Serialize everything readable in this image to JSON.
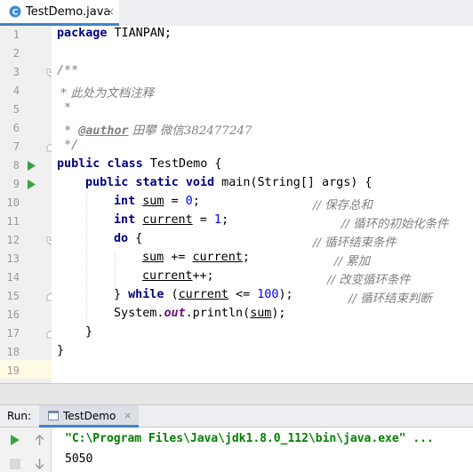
{
  "tab": {
    "filename": "TestDemo.java",
    "close": "×",
    "icon": "java-class-icon"
  },
  "lines": [
    {
      "n": "1"
    },
    {
      "n": "2"
    },
    {
      "n": "3"
    },
    {
      "n": "4"
    },
    {
      "n": "5"
    },
    {
      "n": "6"
    },
    {
      "n": "7"
    },
    {
      "n": "8"
    },
    {
      "n": "9"
    },
    {
      "n": "10"
    },
    {
      "n": "11"
    },
    {
      "n": "12"
    },
    {
      "n": "13"
    },
    {
      "n": "14"
    },
    {
      "n": "15"
    },
    {
      "n": "16"
    },
    {
      "n": "17"
    },
    {
      "n": "18"
    },
    {
      "n": "19"
    }
  ],
  "code": {
    "l1_kw": "package",
    "l1_rest": " TIANPAN;",
    "l3": "/**",
    "l4": " * 此处为文档注释",
    "l5": " *",
    "l6_a": " * ",
    "l6_tag": "@author",
    "l6_b": " 田攀 微信382477247",
    "l7": " */",
    "l8_kw": "public class",
    "l8_rest": " TestDemo {",
    "l9_kw": "public static void",
    "l9_rest": " main(String[] args) {",
    "l10_kw": "int",
    "l10_var": "sum",
    "l10_a": " = ",
    "l10_num": "0",
    "l10_b": ";",
    "l10_cmt": "// 保存总和",
    "l11_kw": "int",
    "l11_var": "current",
    "l11_a": " = ",
    "l11_num": "1",
    "l11_b": ";",
    "l11_cmt": "// 循环的初始化条件",
    "l12_kw": "do",
    "l12_rest": " {",
    "l12_cmt": "// 循环结束条件",
    "l13_var1": "sum",
    "l13_a": " += ",
    "l13_var2": "current",
    "l13_b": ";",
    "l13_cmt": "// 累加",
    "l14_var": "current",
    "l14_a": "++;",
    "l14_cmt": "// 改变循环条件",
    "l15_a": "} ",
    "l15_kw": "while",
    "l15_b": " (",
    "l15_var": "current",
    "l15_c": " <= ",
    "l15_num": "100",
    "l15_d": ");",
    "l15_cmt": "// 循环结束判断",
    "l16_a": "System.",
    "l16_stat": "out",
    "l16_b": ".println(",
    "l16_var": "sum",
    "l16_c": ");",
    "l17": "}",
    "l18": "}"
  },
  "run": {
    "label": "Run:",
    "tab_name": "TestDemo",
    "close": "×",
    "icons": [
      "run-icon",
      "scroll-up-icon",
      "stop-icon",
      "scroll-down-icon"
    ],
    "console": [
      "\"C:\\Program Files\\Java\\jdk1.8.0_112\\bin\\java.exe\" ...",
      "5050"
    ]
  },
  "colors": {
    "keyword": "#000080",
    "number": "#0000ff",
    "comment": "#808080",
    "string": "#008000",
    "run_green": "#3aa144",
    "accent": "#4083c9"
  }
}
